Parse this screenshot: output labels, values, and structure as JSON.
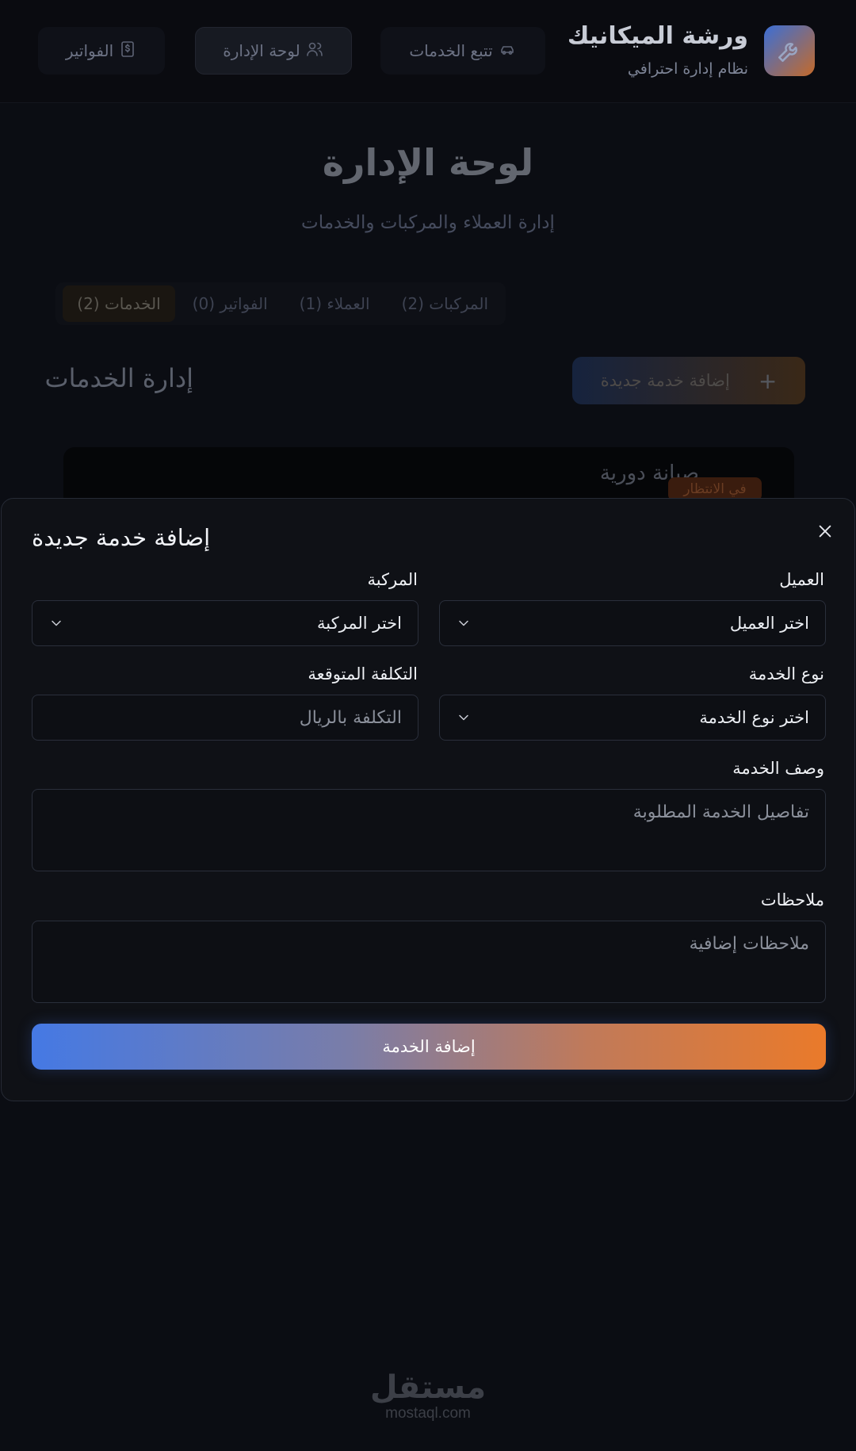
{
  "header": {
    "brand_title": "ورشة الميكانيك",
    "brand_subtitle": "نظام إدارة احترافي",
    "nav": {
      "services_tracking": "تتبع الخدمات",
      "admin_panel": "لوحة الإدارة",
      "invoices": "الفواتير"
    }
  },
  "page": {
    "title": "لوحة الإدارة",
    "subtitle": "إدارة العملاء والمركبات والخدمات",
    "tabs": [
      {
        "label": "الخدمات (2)",
        "active": true
      },
      {
        "label": "الفواتير (0)",
        "active": false
      },
      {
        "label": "العملاء (1)",
        "active": false
      },
      {
        "label": "المركبات (2)",
        "active": false
      }
    ],
    "section_title": "إدارة الخدمات",
    "add_button": "إضافة خدمة جديدة",
    "card": {
      "title": "صيانة دورية",
      "status": "في الانتظار"
    }
  },
  "modal": {
    "title": "إضافة خدمة جديدة",
    "fields": {
      "customer": {
        "label": "العميل",
        "value": "اختر العميل"
      },
      "vehicle": {
        "label": "المركبة",
        "value": "اختر المركبة"
      },
      "service_type": {
        "label": "نوع الخدمة",
        "value": "اختر نوع الخدمة"
      },
      "expected_cost": {
        "label": "التكلفة المتوقعة",
        "placeholder": "التكلفة بالريال"
      },
      "description": {
        "label": "وصف الخدمة",
        "placeholder": "تفاصيل الخدمة المطلوبة"
      },
      "notes": {
        "label": "ملاحظات",
        "placeholder": "ملاحظات إضافية"
      }
    },
    "submit": "إضافة الخدمة"
  },
  "watermark": {
    "arabic": "مستقل",
    "latin": "mostaql.com"
  },
  "colors": {
    "background": "#0b0d13",
    "modal": "#0f1116",
    "accent_blue": "#4579e4",
    "accent_orange": "#ea7a2a"
  }
}
